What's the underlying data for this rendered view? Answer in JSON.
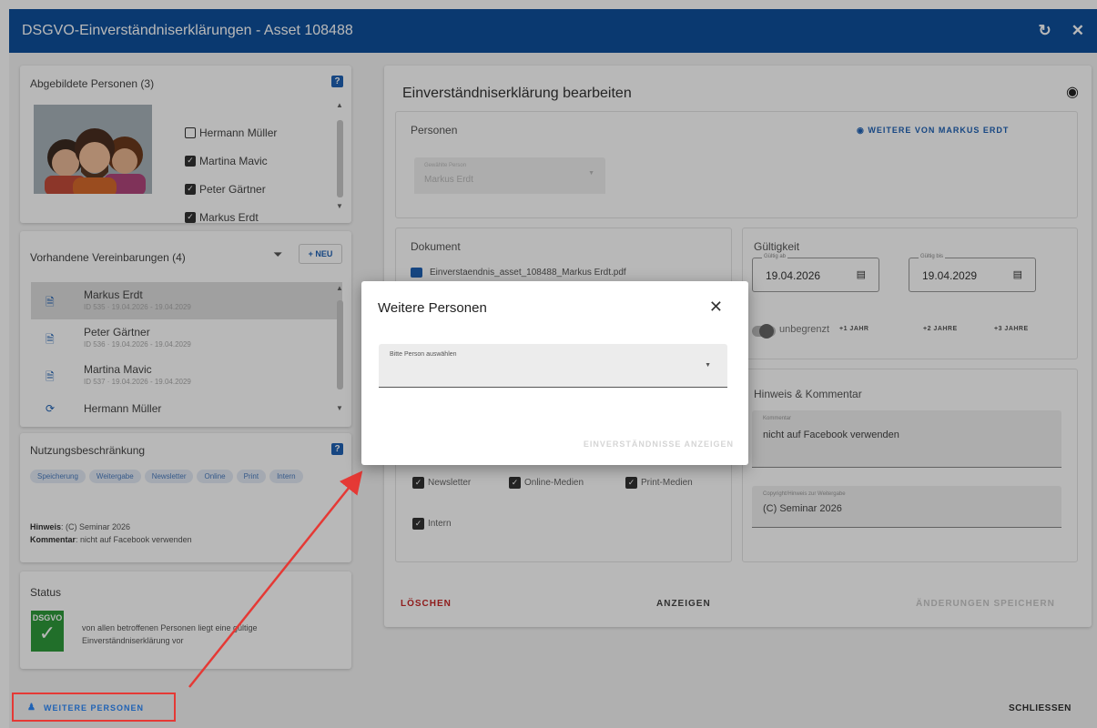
{
  "window": {
    "title": "DSGVO-Einverständniserklärungen - Asset 108488",
    "refresh_icon": "refresh-icon",
    "close_icon": "close-icon"
  },
  "persons": {
    "title": "Abgebildete Personen (3)",
    "help": "?",
    "items": [
      {
        "name": "Hermann Müller",
        "checked": false
      },
      {
        "name": "Martina Mavic",
        "checked": true
      },
      {
        "name": "Peter Gärtner",
        "checked": true
      },
      {
        "name": "Markus Erdt",
        "checked": true
      }
    ]
  },
  "agreements": {
    "title": "Vorhandene Vereinbarungen (4)",
    "new_label": "+ NEU",
    "items": [
      {
        "name": "Markus Erdt",
        "sub": "ID 535 · 19.04.2026 - 19.04.2029",
        "selected": true,
        "icon": "document-icon"
      },
      {
        "name": "Peter Gärtner",
        "sub": "ID 536 · 19.04.2026 - 19.04.2029",
        "selected": false,
        "icon": "document-icon"
      },
      {
        "name": "Martina Mavic",
        "sub": "ID 537 · 19.04.2026 - 19.04.2029",
        "selected": false,
        "icon": "document-icon"
      },
      {
        "name": "Hermann Müller",
        "sub": "",
        "selected": false,
        "icon": "sync-icon"
      }
    ]
  },
  "usage": {
    "title": "Nutzungsbeschränkung",
    "help": "?",
    "chips": [
      "Speicherung",
      "Weitergabe",
      "Newsletter",
      "Online",
      "Print",
      "Intern"
    ],
    "hint_label": "Hinweis",
    "hint_value": ": (C) Seminar 2026",
    "comment_label": "Kommentar",
    "comment_value": ": nicht auf Facebook verwenden"
  },
  "status": {
    "title": "Status",
    "badge": "DSGVO",
    "text": "von allen betroffenen Personen liegt eine gültige Einverständniserklärung vor"
  },
  "edit": {
    "title": "Einverständniserklärung bearbeiten",
    "persons_title": "Personen",
    "more_from": "WEITERE VON MARKUS ERDT",
    "selected_person_label": "Gewählte Person",
    "selected_person_value": "Markus Erdt",
    "document_title": "Dokument",
    "document_file": "Einverstaendnis_asset_108488_Markus Erdt.pdf",
    "validity_title": "Gültigkeit",
    "valid_from_label": "Gültig ab",
    "valid_from": "19.04.2026",
    "valid_to_label": "Gültig bis",
    "valid_to": "19.04.2029",
    "unlimited": "unbegrenzt",
    "plus1": "+1 JAHR",
    "plus2": "+2 JAHRE",
    "plus3": "+3 JAHRE",
    "media": [
      "Newsletter",
      "Online-Medien",
      "Print-Medien"
    ],
    "internal": "Intern",
    "hint_title": "Hinweis & Kommentar",
    "comment_label": "Kommentar",
    "comment_value": "nicht auf Facebook verwenden",
    "copyright_label": "Copyright/Hinweis zur Weitergabe",
    "copyright_value": "(C) Seminar 2026",
    "delete": "LÖSCHEN",
    "show": "ANZEIGEN",
    "save": "ÄNDERUNGEN SPEICHERN"
  },
  "footer": {
    "more_persons": "WEITERE PERSONEN",
    "close": "SCHLIESSEN"
  },
  "modal": {
    "title": "Weitere Personen",
    "select_label": "Bitte Person auswählen",
    "action": "EINVERSTÄNDNISSE ANZEIGEN"
  },
  "colors": {
    "titlebar": "#0e4f9c",
    "accent": "#1f62b5",
    "danger": "#c62828",
    "annotation": "#e53935",
    "status_ok": "#2e9a3b"
  }
}
